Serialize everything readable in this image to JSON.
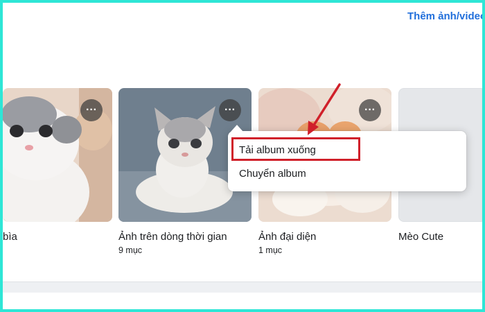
{
  "header": {
    "add_photos_link": "Thêm ảnh/video"
  },
  "albums": [
    {
      "title": "bìa",
      "count": ""
    },
    {
      "title": "Ảnh trên dòng thời gian",
      "count": "9 mục"
    },
    {
      "title": "Ảnh đại diện",
      "count": "1 mục"
    },
    {
      "title": "Mèo Cute",
      "count": ""
    }
  ],
  "more_button_glyph": "···",
  "context_menu": {
    "items": [
      "Tải album xuống",
      "Chuyển album"
    ]
  },
  "colors": {
    "link": "#216fdb",
    "highlight": "#d0202a",
    "frame": "#2ee6d6"
  }
}
